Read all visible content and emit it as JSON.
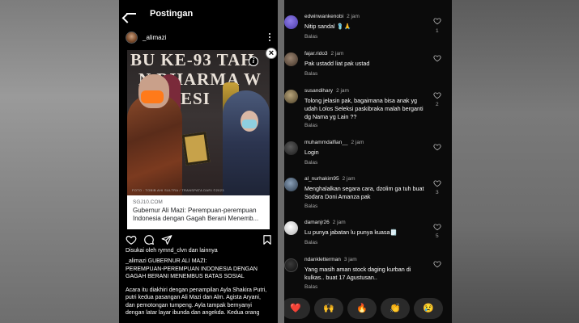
{
  "left": {
    "header": {
      "title": "Postingan"
    },
    "post_user": {
      "username": "_alimazi"
    },
    "link_card": {
      "banner_lines": [
        "BU KE-93 TAH",
        "N DHARMA W",
        "WESI"
      ],
      "watermark": "FOTO : TOBIB AHI SULTRA / TRANSPATA DARI ©2023",
      "source": "SGJ10.COM",
      "title_line1": "Gubernur Ali Mazi: Perempuan-perempuan",
      "title_line2": "Indonesia dengan Gagah Berani Menemb..."
    },
    "liked_by": "Disukai oleh rymnd_clvn dan lainnya",
    "caption": {
      "line1": "_alimazi GUBERNUR ALI MAZI:",
      "line2": "PEREMPUAN-PEREMPUAN INDONESIA DENGAN",
      "line3": "GAGAH BERANI MENEMBUS BATAS SOSIAL",
      "body1": "Acara itu diakhiri dengan penampilan Ayla Shakira Putri,",
      "body2": "putri kedua pasangan Ali Mazi dan Alm. Agista Aryani,",
      "body3": "dan pemotongan tumpeng. Ayla tampak bernyanyi",
      "body4": "dengan latar layar ibunda dan angekda. Kedua orang"
    }
  },
  "right": {
    "comments": [
      {
        "user": "edwinwankenobi",
        "time": "2 jam",
        "text": "Nitip sandal 🩴🙏",
        "reply": "Balas",
        "likes": "1",
        "avatar_color": "#6a5acd"
      },
      {
        "user": "fajar.rido3",
        "time": "2 jam",
        "text": "Pak ustadd liat pak ustad",
        "reply": "Balas",
        "likes": "",
        "avatar_color": "#5a4a3a"
      },
      {
        "user": "susandihary",
        "time": "2 jam",
        "text": "Tolong jelasin pak, bagaimana bisa anak yg udah Lolos Seleksi paskibraka malah berganti dg Nama yg Lain ??",
        "reply": "Balas",
        "likes": "2",
        "avatar_color": "#7a6a4a"
      },
      {
        "user": "muhammdalfian__",
        "time": "2 jam",
        "text": "Login",
        "reply": "Balas",
        "likes": "",
        "avatar_color": "#3a3a3a"
      },
      {
        "user": "al_nurhakim95",
        "time": "2 jam",
        "text": "Menghalalkan segara cara, dzolim ga tuh buat Sodara Doni Amanza  pak",
        "reply": "Balas",
        "likes": "3",
        "avatar_color": "#4a5a6a"
      },
      {
        "user": "damanjr26",
        "time": "2 jam",
        "text": "Lu punya jabatan lu punya kuasa🗒️",
        "reply": "Balas",
        "likes": "5",
        "avatar_color": "#d8d8d8"
      },
      {
        "user": "ndankletterman",
        "time": "3 jam",
        "text": "Yang masih aman stock daging kurban di kulkas.. buat 17 Agustusan..",
        "reply": "Balas",
        "likes": "",
        "avatar_color": "#2a2a2a"
      }
    ],
    "emoji_bar": [
      "❤️",
      "🙌",
      "🔥",
      "👏",
      "😢"
    ]
  }
}
